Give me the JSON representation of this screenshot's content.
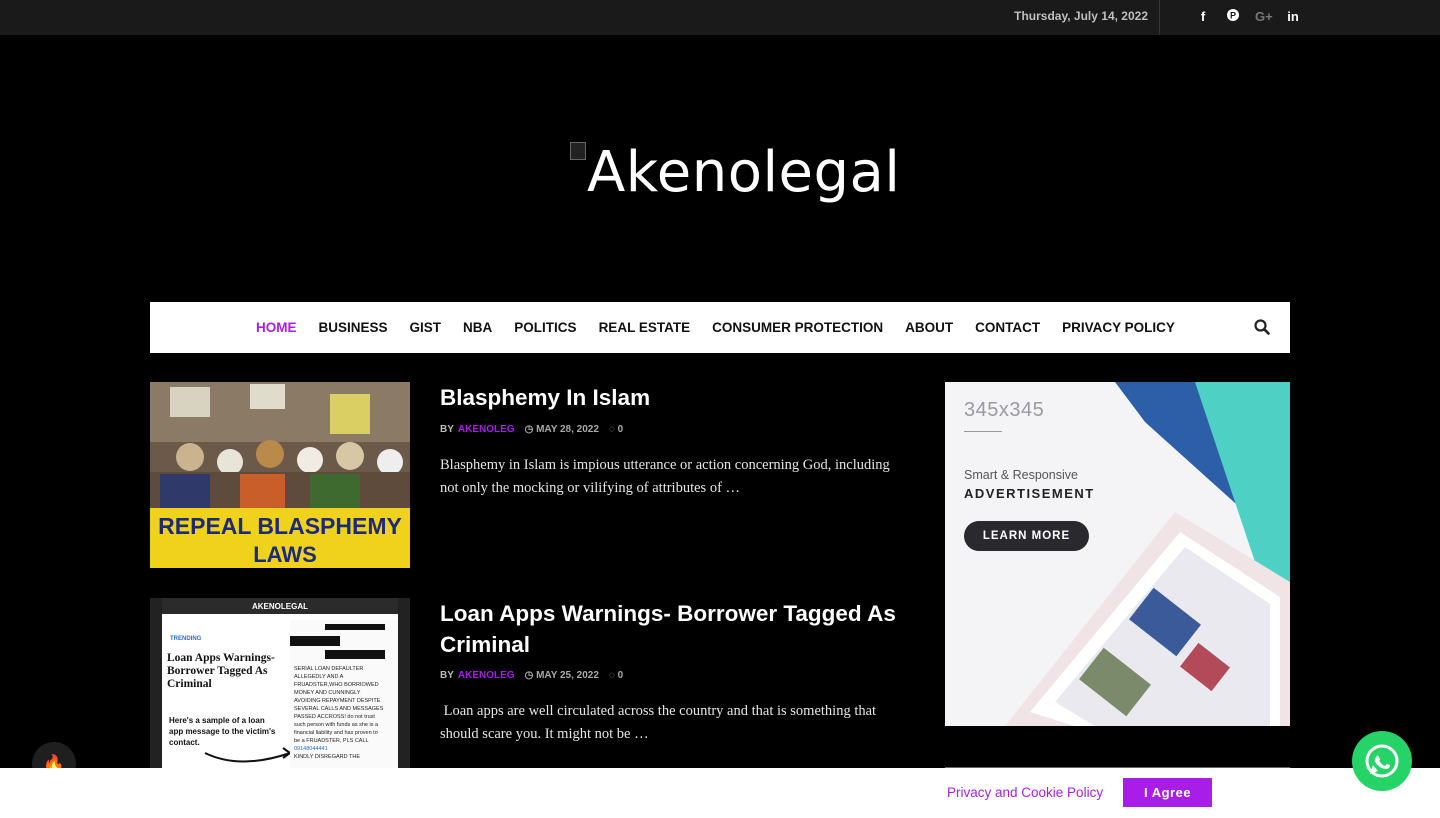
{
  "topbar": {
    "date": "Thursday, July 14, 2022",
    "social_icons": [
      "facebook-icon",
      "pinterest-icon",
      "google-plus-icon",
      "linkedin-icon"
    ]
  },
  "logo": {
    "alt_text": "Akenolegal"
  },
  "nav": {
    "items": [
      "HOME",
      "BUSINESS",
      "GIST",
      "NBA",
      "POLITICS",
      "REAL ESTATE",
      "CONSUMER PROTECTION",
      "ABOUT",
      "CONTACT",
      "PRIVACY POLICY"
    ],
    "active": "HOME",
    "search_icon": "search-icon"
  },
  "posts": [
    {
      "title": "Blasphemy In Islam",
      "by": "BY",
      "author": "AKENOLEG",
      "date": "MAY 28, 2022",
      "comments": "0",
      "excerpt": "Blasphemy in Islam is impious utterance or action concerning God, including not only the mocking or vilifying of attributes of …",
      "thumb_banner": "REPEAL BLASPHEMY LAWS"
    },
    {
      "title": "Loan Apps Warnings- Borrower Tagged As Criminal",
      "by": "BY",
      "author": "AKENOLEG",
      "date": "MAY 25, 2022",
      "comments": "0",
      "excerpt": " Loan apps are well circulated across the country and that is something that should scare you. It might not be …",
      "thumb_heading": "Loan Apps Warnings- Borrower Tagged As Criminal",
      "thumb_caption": "Here's a sample of a loan app message to the victim's contact.",
      "thumb_brand": "AKENOLEGAL",
      "thumb_tag": "TRENDING"
    }
  ],
  "ad": {
    "size": "345x345",
    "tagline": "Smart & Responsive",
    "headline": "ADVERTISEMENT",
    "button": "LEARN MORE"
  },
  "cookie": {
    "text": "Privacy and Cookie Policy",
    "button": "I Agree"
  },
  "colors": {
    "accent": "#a81ee8",
    "whatsapp": "#25d366"
  }
}
